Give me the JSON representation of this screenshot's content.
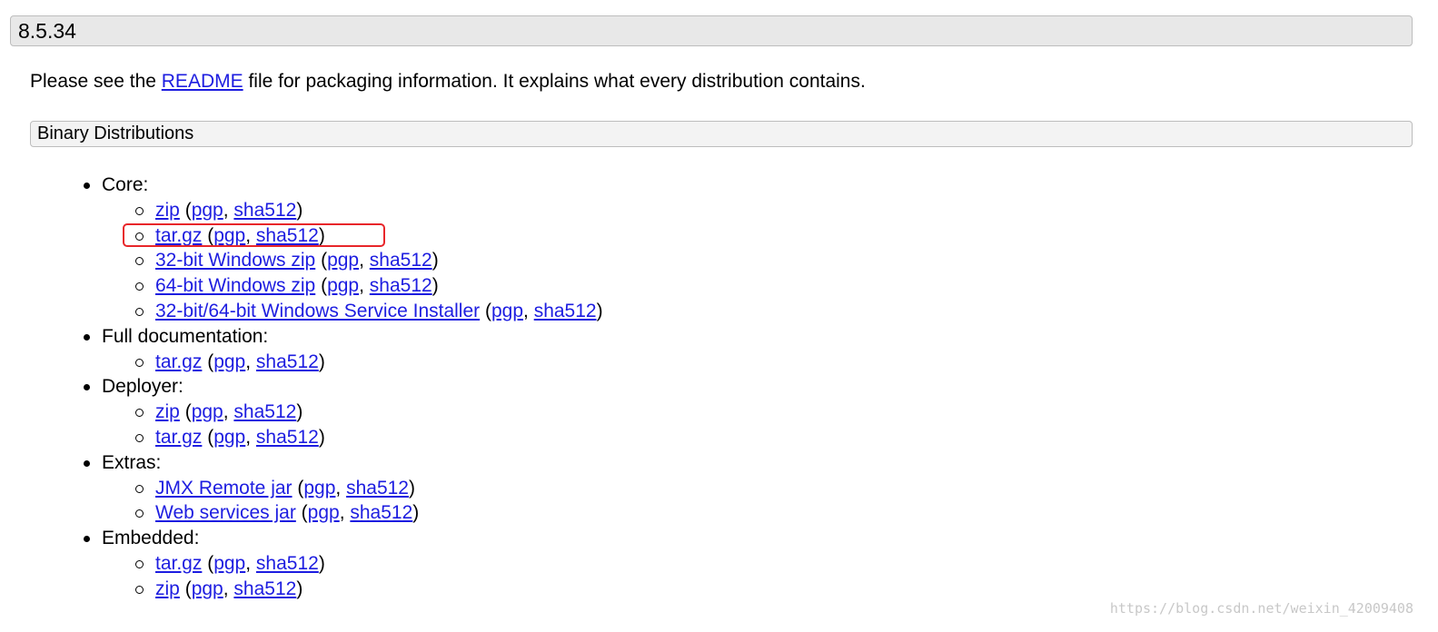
{
  "version_header": "8.5.34",
  "intro": {
    "before": "Please see the ",
    "link": "README",
    "after": " file for packaging information. It explains what every distribution contains."
  },
  "section_header": "Binary Distributions",
  "groups": [
    {
      "label": "Core:",
      "items": [
        {
          "name": "zip",
          "pgp": "pgp",
          "sha": "sha512"
        },
        {
          "name": "tar.gz",
          "pgp": "pgp",
          "sha": "sha512"
        },
        {
          "name": "32-bit Windows zip",
          "pgp": "pgp",
          "sha": "sha512"
        },
        {
          "name": "64-bit Windows zip",
          "pgp": "pgp",
          "sha": "sha512"
        },
        {
          "name": "32-bit/64-bit Windows Service Installer",
          "pgp": "pgp",
          "sha": "sha512"
        }
      ]
    },
    {
      "label": "Full documentation:",
      "items": [
        {
          "name": "tar.gz",
          "pgp": "pgp",
          "sha": "sha512"
        }
      ]
    },
    {
      "label": "Deployer:",
      "items": [
        {
          "name": "zip",
          "pgp": "pgp",
          "sha": "sha512"
        },
        {
          "name": "tar.gz",
          "pgp": "pgp",
          "sha": "sha512"
        }
      ]
    },
    {
      "label": "Extras:",
      "items": [
        {
          "name": "JMX Remote jar",
          "pgp": "pgp",
          "sha": "sha512"
        },
        {
          "name": "Web services jar",
          "pgp": "pgp",
          "sha": "sha512"
        }
      ]
    },
    {
      "label": "Embedded:",
      "items": [
        {
          "name": "tar.gz",
          "pgp": "pgp",
          "sha": "sha512"
        },
        {
          "name": "zip",
          "pgp": "pgp",
          "sha": "sha512"
        }
      ]
    }
  ],
  "punct": {
    "open": " (",
    "comma": ", ",
    "close": ")"
  },
  "colors": {
    "link": "#1d1de0",
    "highlight": "#e8262a",
    "header_bg": "#e8e8e8"
  },
  "watermark": "https://blog.csdn.net/weixin_42009408"
}
